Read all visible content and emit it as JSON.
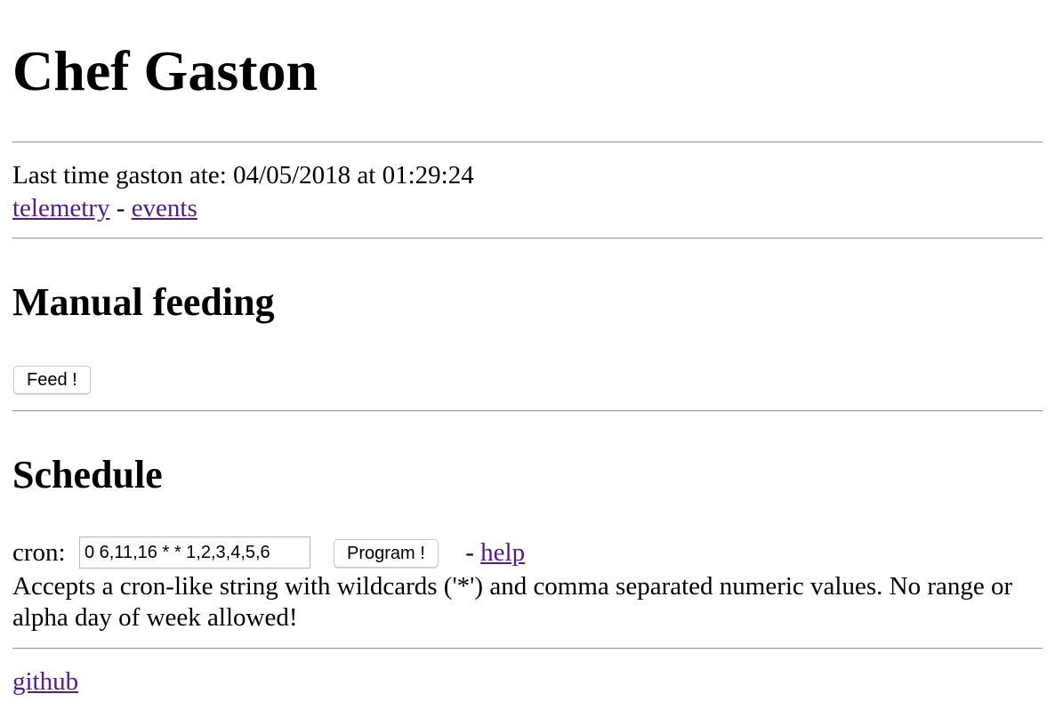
{
  "header": {
    "title": "Chef Gaston"
  },
  "status": {
    "last_fed_prefix": "Last time gaston ate: ",
    "last_fed_value": "04/05/2018 at 01:29:24"
  },
  "links": {
    "telemetry": "telemetry",
    "separator": " - ",
    "events": "events"
  },
  "manual": {
    "heading": "Manual feeding",
    "feed_button": "Feed !"
  },
  "schedule": {
    "heading": "Schedule",
    "cron_label": "cron:",
    "cron_value": "0 6,11,16 * * 1,2,3,4,5,6",
    "program_button": "Program !",
    "help_separator": " - ",
    "help_link": "help",
    "description": "Accepts a cron-like string with wildcards ('*') and comma separated numeric values. No range or alpha day of week allowed!"
  },
  "footer": {
    "github_link": "github"
  }
}
